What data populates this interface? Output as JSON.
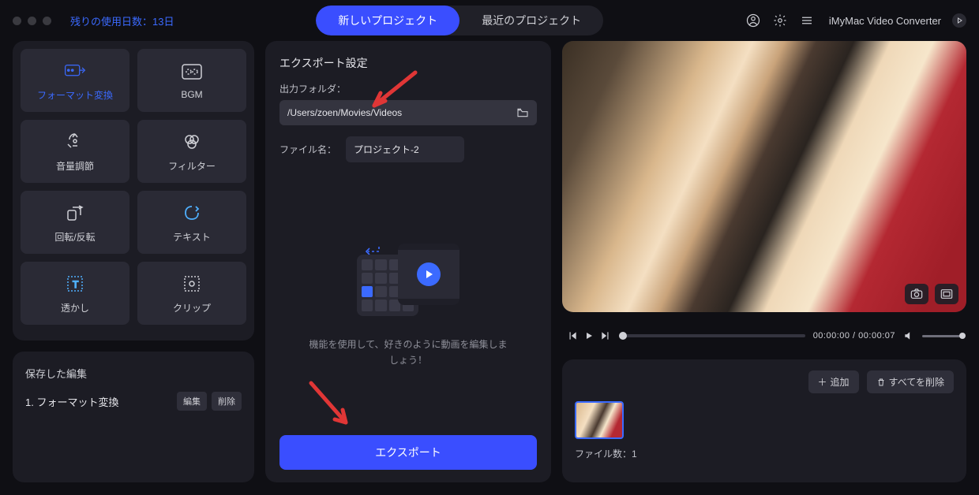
{
  "header": {
    "trial_label": "残りの使用日数：13日",
    "tab_new": "新しいプロジェクト",
    "tab_recent": "最近のプロジェクト",
    "app_name": "iMyMac Video Converter"
  },
  "tools": {
    "format": "フォーマット変換",
    "bgm": "BGM",
    "volume": "音量調節",
    "filter": "フィルター",
    "rotate": "回転/反転",
    "text": "テキスト",
    "watermark": "透かし",
    "clip": "クリップ"
  },
  "saved": {
    "title": "保存した編集",
    "item1": "1.  フォーマット変換",
    "edit": "編集",
    "delete": "削除"
  },
  "export": {
    "title": "エクスポート設定",
    "folder_label": "出力フォルダ：",
    "folder_value": "/Users/zoen/Movies/Videos",
    "filename_label": "ファイル名：",
    "filename_value": "プロジェクト-2",
    "hint": "機能を使用して、好きのように動画を編集しましょう！",
    "button": "エクスポート"
  },
  "player": {
    "time": "00:00:00 / 00:00:07"
  },
  "files": {
    "add": "追加",
    "delete_all": "すべてを削除",
    "count": "ファイル数：1"
  }
}
